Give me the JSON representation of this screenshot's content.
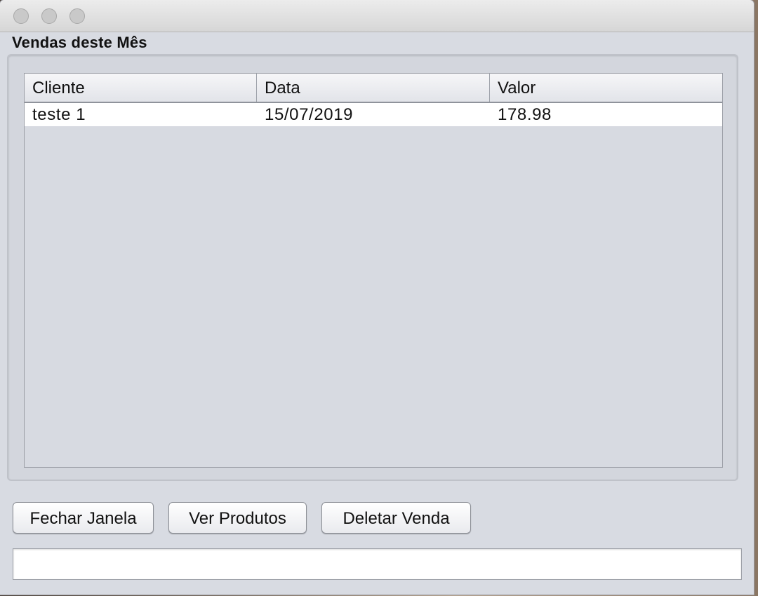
{
  "window": {
    "title": "",
    "controls": [
      "close-icon",
      "minimize-icon",
      "zoom-icon"
    ]
  },
  "panel": {
    "title": "Vendas deste Mês"
  },
  "table": {
    "columns": [
      "Cliente",
      "Data",
      "Valor"
    ],
    "rows": [
      [
        "teste 1",
        "15/07/2019",
        "178.98"
      ]
    ]
  },
  "buttons": {
    "close_window": "Fechar Janela",
    "view_products": "Ver Produtos",
    "delete_sale": "Deletar Venda"
  },
  "status_field": {
    "value": ""
  }
}
